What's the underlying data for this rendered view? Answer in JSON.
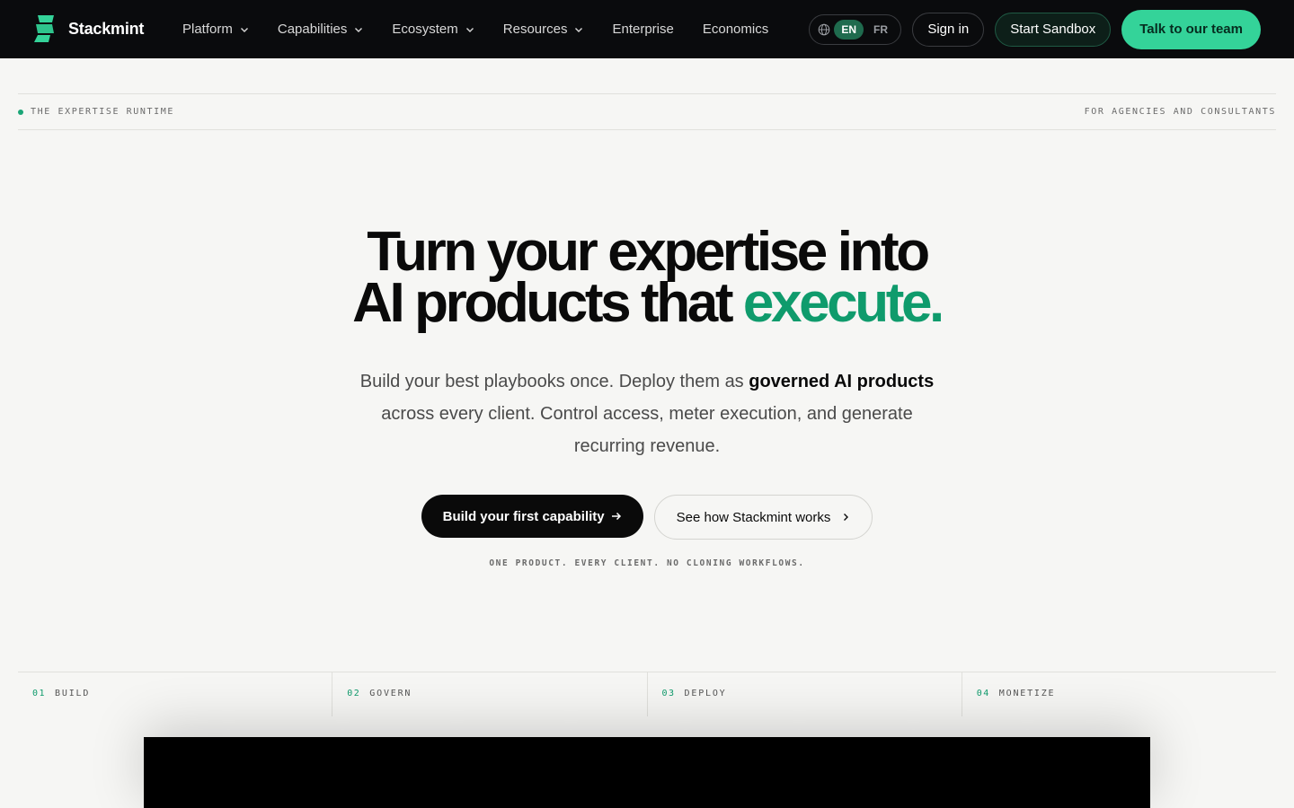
{
  "brand": {
    "name": "Stackmint",
    "logo_icon": "stackmint-logo-icon",
    "accent": "#34d399"
  },
  "nav": {
    "items": [
      {
        "label": "Platform",
        "has_dropdown": true
      },
      {
        "label": "Capabilities",
        "has_dropdown": true
      },
      {
        "label": "Ecosystem",
        "has_dropdown": true
      },
      {
        "label": "Resources",
        "has_dropdown": true
      },
      {
        "label": "Enterprise",
        "has_dropdown": false
      },
      {
        "label": "Economics",
        "has_dropdown": false
      }
    ],
    "language": {
      "icon": "globe-icon",
      "options": [
        "EN",
        "FR"
      ],
      "selected": "EN"
    },
    "sign_in": "Sign in",
    "start_sandbox": "Start Sandbox",
    "talk": "Talk to our team"
  },
  "eyebrow": {
    "left": "THE EXPERTISE RUNTIME",
    "right": "FOR AGENCIES AND CONSULTANTS"
  },
  "hero": {
    "title_line1": "Turn your expertise into",
    "title_line2_prefix": "AI products that",
    "title_line2_accent": "execute.",
    "subtitle_part1": "Build your best playbooks once. Deploy them as",
    "subtitle_bold": "governed AI products",
    "subtitle_part2": "across every client. Control access, meter execution, and generate recurring revenue.",
    "primary_cta": "Build your first capability",
    "secondary_cta": "See how Stackmint works",
    "note": "ONE PRODUCT. EVERY CLIENT. NO CLONING WORKFLOWS."
  },
  "steps": [
    {
      "num": "01",
      "label": "BUILD"
    },
    {
      "num": "02",
      "label": "GOVERN"
    },
    {
      "num": "03",
      "label": "DEPLOY"
    },
    {
      "num": "04",
      "label": "MONETIZE"
    }
  ]
}
